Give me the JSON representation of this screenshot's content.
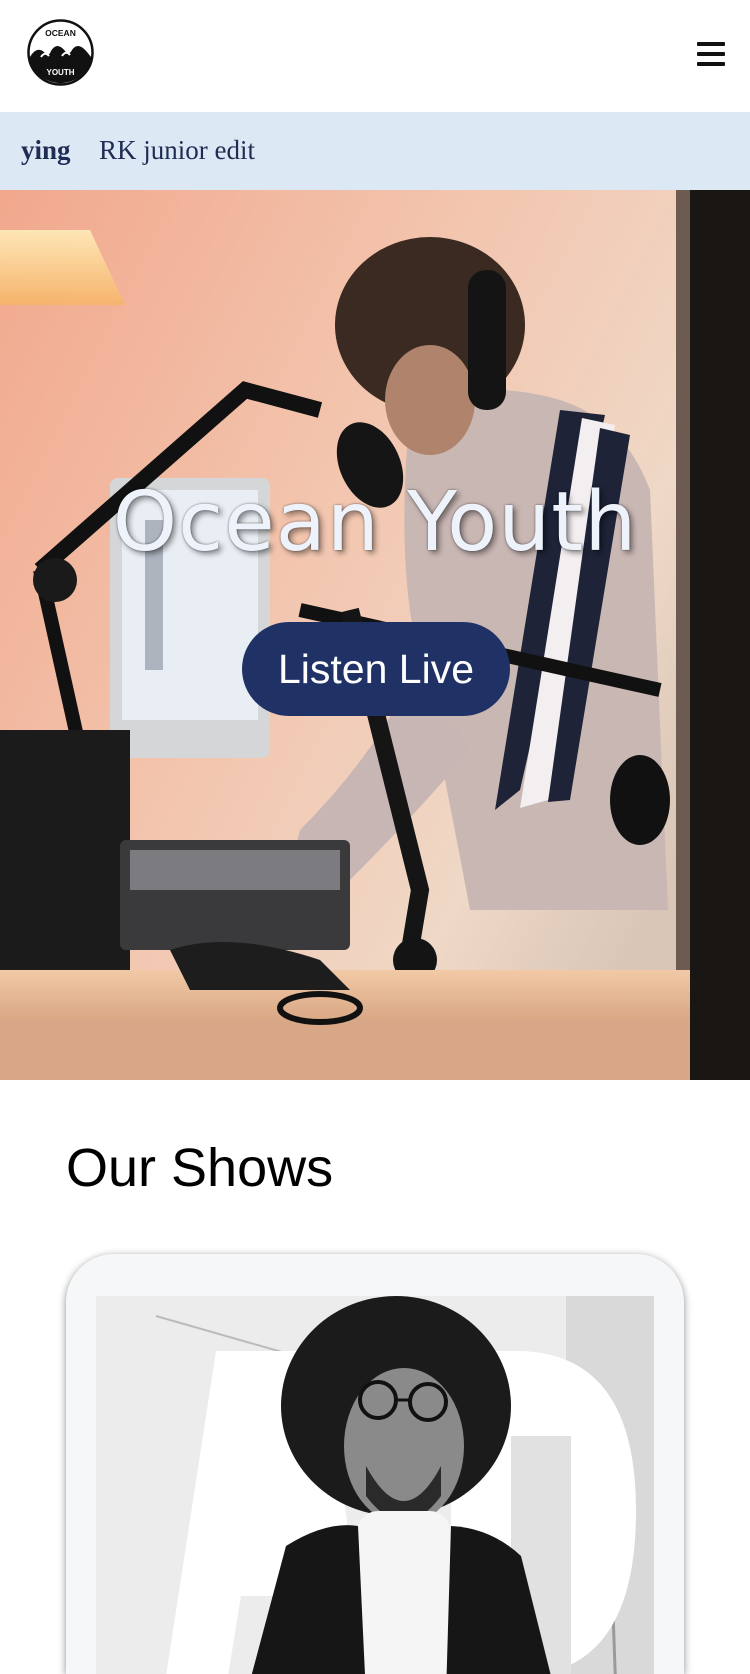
{
  "header": {
    "logo": {
      "top_text": "OCEAN",
      "bottom_text": "YOUTH",
      "icon": "wave-logo-icon"
    },
    "menu_icon": "hamburger-menu-icon"
  },
  "ticker": {
    "now_playing": "ying",
    "next_item": "RK junior edit"
  },
  "hero": {
    "title": "Ocean Youth",
    "cta_label": "Listen Live"
  },
  "shows": {
    "heading": "Our Shows"
  },
  "colors": {
    "ticker_bg": "#dde8f5",
    "ticker_text": "#1f2d54",
    "cta_bg": "#1f3165",
    "hero_title": "#eef3fb"
  }
}
